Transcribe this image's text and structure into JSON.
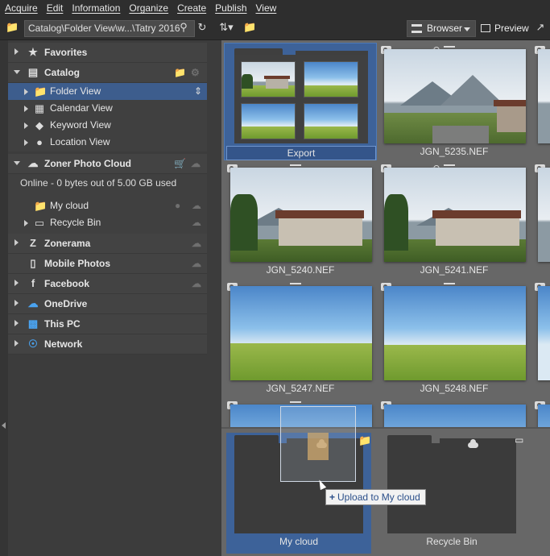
{
  "menu": [
    "Acquire",
    "Edit",
    "Information",
    "Organize",
    "Create",
    "Publish",
    "View"
  ],
  "toolbar": {
    "path": "Catalog\\Folder View\\w...\\Tatry 2016",
    "browser_label": "Browser",
    "preview_label": "Preview"
  },
  "sidebar": {
    "favorites": "Favorites",
    "catalog": "Catalog",
    "catalog_items": [
      "Folder View",
      "Calendar View",
      "Keyword View",
      "Location View"
    ],
    "cloud": "Zoner Photo Cloud",
    "cloud_status": "Online - 0 bytes out of 5.00 GB used",
    "cloud_items": [
      "My cloud",
      "Recycle Bin"
    ],
    "zonerama": "Zonerama",
    "mobile": "Mobile Photos",
    "facebook": "Facebook",
    "onedrive": "OneDrive",
    "thispc": "This PC",
    "network": "Network"
  },
  "grid": {
    "items": [
      "Export",
      "JGN_5235.NEF",
      "JGN_5240.NEF",
      "JGN_5241.NEF",
      "JGN_5247.NEF",
      "JGN_5248.NEF"
    ]
  },
  "bottom": {
    "items": [
      "My cloud",
      "Recycle Bin"
    ]
  },
  "drag": {
    "tooltip": "Upload to My cloud"
  }
}
